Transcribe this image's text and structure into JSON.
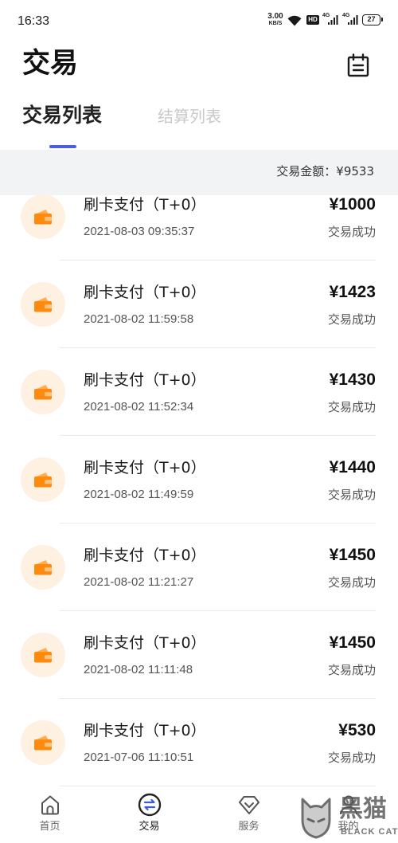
{
  "status_bar": {
    "time": "16:33",
    "net_speed_value": "3.00",
    "net_speed_unit": "KB/S",
    "hd_badge": "HD",
    "signal_1": "4G",
    "signal_2": "4G",
    "battery": "27",
    "icons": [
      "wifi-icon",
      "hd-icon",
      "signal-icon",
      "signal-icon",
      "battery-icon"
    ]
  },
  "header": {
    "title": "交易",
    "action_icon": "calendar-icon"
  },
  "tabs": [
    {
      "label": "交易列表",
      "active": true
    },
    {
      "label": "结算列表",
      "active": false
    }
  ],
  "summary": {
    "label": "交易金额：",
    "value": "¥9533"
  },
  "transactions": [
    {
      "icon": "wallet-icon",
      "title": "刷卡支付（T+0）",
      "time": "2021-08-03 09:35:37",
      "amount": "¥1000",
      "status": "交易成功"
    },
    {
      "icon": "wallet-icon",
      "title": "刷卡支付（T+0）",
      "time": "2021-08-02 11:59:58",
      "amount": "¥1423",
      "status": "交易成功"
    },
    {
      "icon": "wallet-icon",
      "title": "刷卡支付（T+0）",
      "time": "2021-08-02 11:52:34",
      "amount": "¥1430",
      "status": "交易成功"
    },
    {
      "icon": "wallet-icon",
      "title": "刷卡支付（T+0）",
      "time": "2021-08-02 11:49:59",
      "amount": "¥1440",
      "status": "交易成功"
    },
    {
      "icon": "wallet-icon",
      "title": "刷卡支付（T+0）",
      "time": "2021-08-02 11:21:27",
      "amount": "¥1450",
      "status": "交易成功"
    },
    {
      "icon": "wallet-icon",
      "title": "刷卡支付（T+0）",
      "time": "2021-08-02 11:11:48",
      "amount": "¥1450",
      "status": "交易成功"
    },
    {
      "icon": "wallet-icon",
      "title": "刷卡支付（T+0）",
      "time": "2021-07-06 11:10:51",
      "amount": "¥530",
      "status": "交易成功"
    }
  ],
  "bottom_nav": [
    {
      "label": "首页",
      "icon": "home-icon",
      "active": false
    },
    {
      "label": "交易",
      "icon": "exchange-icon",
      "active": true
    },
    {
      "label": "服务",
      "icon": "diamond-icon",
      "active": false
    },
    {
      "label": "我的",
      "icon": "user-icon",
      "active": false
    }
  ],
  "watermark": {
    "text": "黑猫",
    "subtext": "BLACK CAT"
  },
  "colors": {
    "accent": "#4A5FD9",
    "wallet_orange": "#FF8A0D",
    "wallet_icon_bg": "#FEF1E2",
    "summary_bg": "#F2F3F5",
    "tab_inactive": "#C9C9C9",
    "exchange_arrows": "#3B5BDB"
  }
}
